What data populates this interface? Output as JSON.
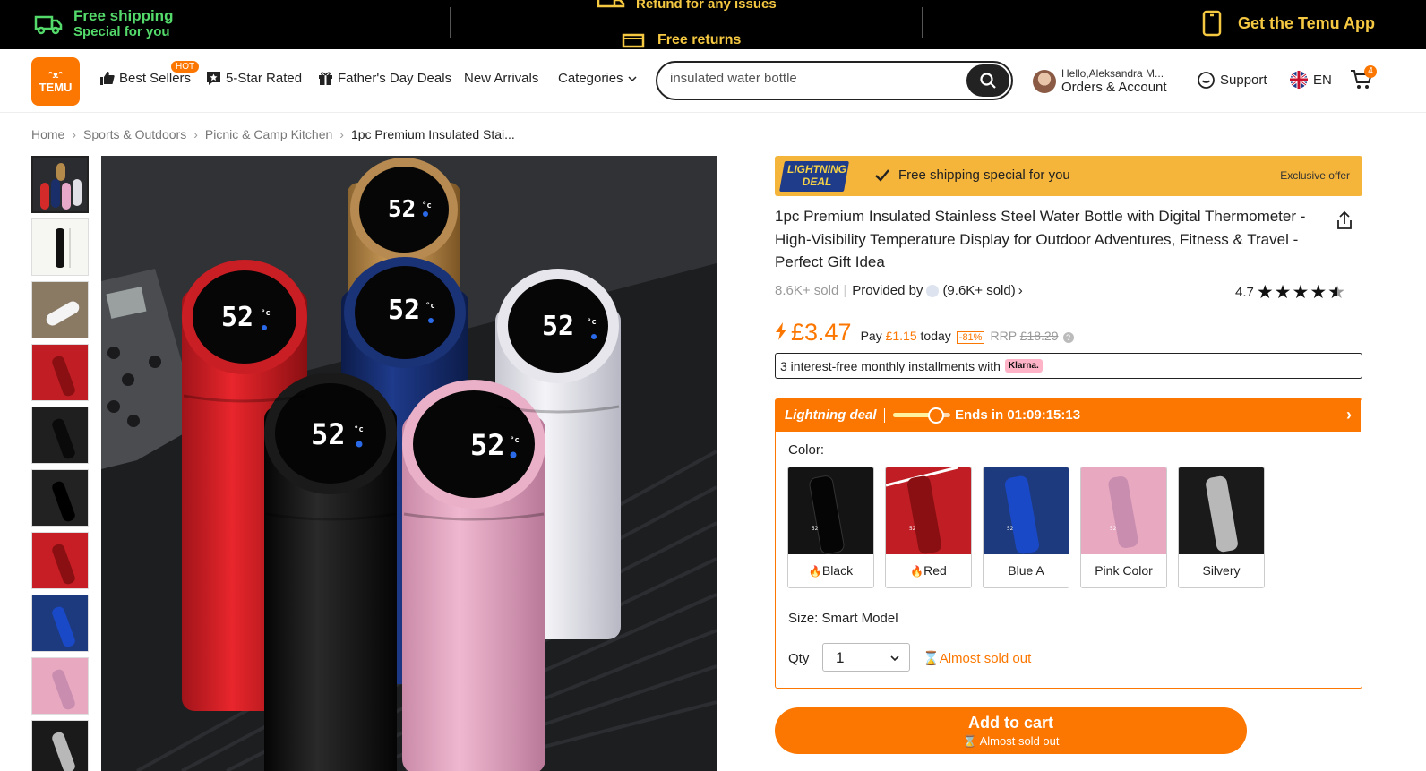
{
  "topbar": {
    "free_shipping": "Free shipping",
    "special_for_you": "Special for you",
    "refund": "Refund for any issues",
    "free_returns": "Free returns",
    "get_app": "Get the Temu App"
  },
  "header": {
    "logo_top": "ᵔᴥᵔ",
    "logo_text": "TEMU",
    "nav": {
      "best_sellers": "Best Sellers",
      "hot_badge": "HOT",
      "five_star": "5-Star Rated",
      "fathers_day": "Father's Day Deals",
      "new_arrivals": "New Arrivals",
      "categories": "Categories"
    },
    "search_value": "insulated water bottle",
    "account_greeting": "Hello,Aleksandra M...",
    "account_label": "Orders & Account",
    "support": "Support",
    "language": "EN",
    "cart_count": "4"
  },
  "breadcrumb": [
    "Home",
    "Sports & Outdoors",
    "Picnic & Camp Kitchen",
    "1pc Premium Insulated Stai..."
  ],
  "deal_bar": {
    "badge_line1": "LIGHTNING",
    "badge_line2": "DEAL",
    "message": "Free shipping special for you",
    "exclusive": "Exclusive offer"
  },
  "product": {
    "title": "1pc Premium Insulated Stainless Steel Water Bottle with Digital Thermometer - High-Visibility Temperature Display for Outdoor Adventures, Fitness & Travel - Perfect Gift Idea",
    "sold": "8.6K+ sold",
    "provided_by": "Provided by",
    "provider_sold": "(9.6K+ sold)",
    "rating": "4.7",
    "rating_value": 4.7,
    "price": "£3.47",
    "pay_prefix": "Pay",
    "pay_amount": "£1.15",
    "pay_suffix": "today",
    "discount": "-81%",
    "rrp_label": "RRP",
    "rrp_value": "£18.29",
    "installments": "3 interest-free monthly installments with",
    "klarna": "Klarna."
  },
  "lightning": {
    "label": "Lightning deal",
    "ends": "Ends in 01:09:15:13",
    "progress": 0.75,
    "color_label": "Color:",
    "colors": [
      {
        "name": "Black",
        "hot": true
      },
      {
        "name": "Red",
        "hot": true
      },
      {
        "name": "Blue A",
        "hot": false
      },
      {
        "name": "Pink Color",
        "hot": false
      },
      {
        "name": "Silvery",
        "hot": false
      }
    ],
    "size_label": "Size: Smart Model",
    "qty_label": "Qty",
    "qty_value": "1",
    "almost_sold": "Almost sold out"
  },
  "cart_button": {
    "label": "Add to cart",
    "sub": "Almost sold out"
  },
  "colors": {
    "accent": "#fb7701",
    "topbar_green": "#54d96b",
    "topbar_yellow": "#f5c842",
    "deal_bar": "#f5b43a"
  }
}
